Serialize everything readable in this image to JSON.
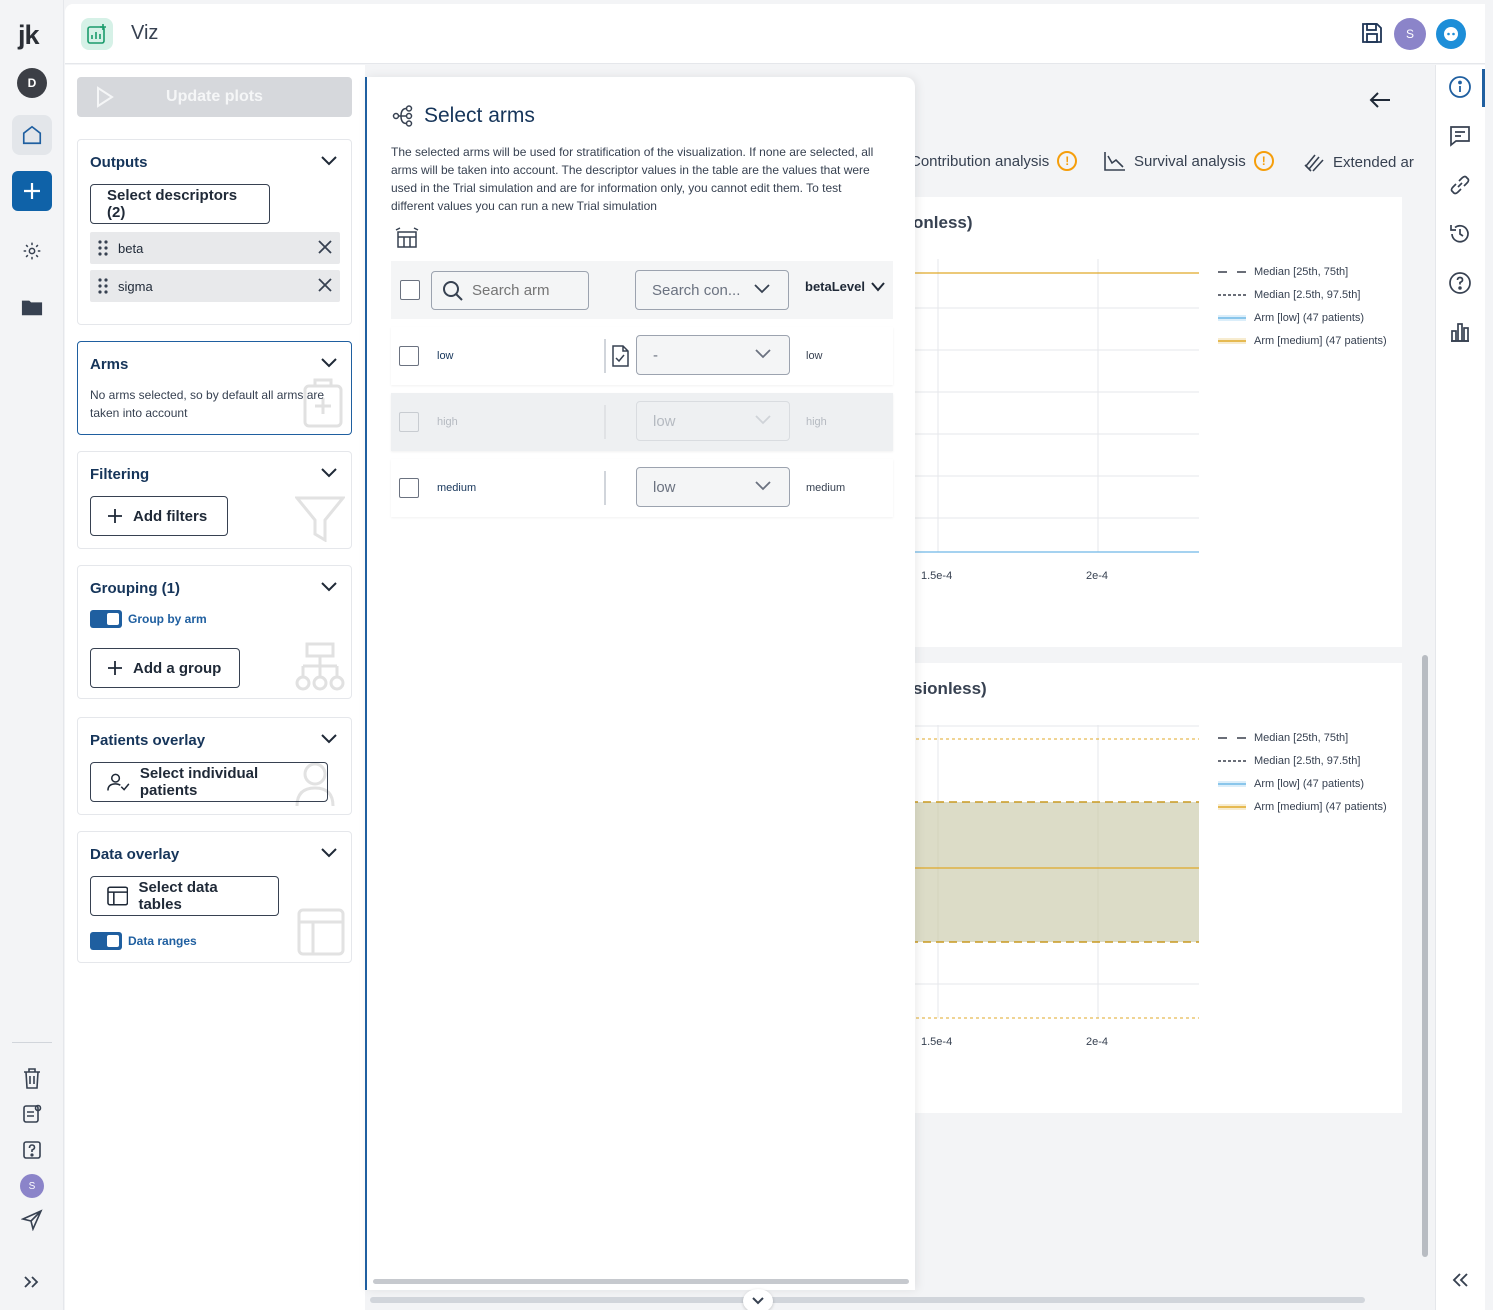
{
  "app": {
    "logo": "jk",
    "title": "Viz",
    "user_initial": "S",
    "workspace_initial": "D"
  },
  "rail": {
    "bottom_user_initial": "S"
  },
  "config": {
    "update_label": "Update plots",
    "outputs": {
      "title": "Outputs",
      "button": "Select descriptors (2)",
      "descriptors": [
        "beta",
        "sigma"
      ]
    },
    "arms": {
      "title": "Arms",
      "note": "No arms selected, so by default all arms are taken into account"
    },
    "filtering": {
      "title": "Filtering",
      "button": "Add filters"
    },
    "grouping": {
      "title": "Grouping (1)",
      "toggle_label": "Group by arm",
      "toggle_on": true,
      "button": "Add a group"
    },
    "patients_overlay": {
      "title": "Patients overlay",
      "button": "Select individual patients"
    },
    "data_overlay": {
      "title": "Data overlay",
      "button": "Select data tables",
      "toggle_label": "Data ranges",
      "toggle_on": true
    }
  },
  "main": {
    "tabs": [
      {
        "label": "Contribution analysis",
        "warning": "!"
      },
      {
        "label": "Survival analysis",
        "warning": "!"
      },
      {
        "label": "Extended ar"
      }
    ],
    "plots": [
      {
        "title_fragment": "onless)",
        "x_ticks": [
          "1.5e-4",
          "2e-4"
        ]
      },
      {
        "title_fragment": "sionless)",
        "x_ticks": [
          "1.5e-4",
          "2e-4"
        ]
      }
    ],
    "legend": [
      {
        "label": "Median [25th, 75th]",
        "style": "dashed-long",
        "color": "#111827"
      },
      {
        "label": "Median [2.5th, 97.5th]",
        "style": "dashed-short",
        "color": "#111827"
      },
      {
        "label": "Arm [low] (47 patients)",
        "style": "band",
        "color": "#6fb8e6"
      },
      {
        "label": "Arm [medium] (47 patients)",
        "style": "band",
        "color": "#e0a928"
      }
    ]
  },
  "overlay": {
    "title": "Select arms",
    "description": "The selected arms will be used for stratification of the visualization. If none are selected, all arms will be taken into account. The descriptor values in the table are the values that were used in the Trial simulation and are for information only, you cannot edit them. To test different values you can run a new Trial simulation",
    "search_placeholder": "Search arm",
    "control_placeholder": "Search con...",
    "column_header": "betaLevel",
    "rows": [
      {
        "name": "low",
        "control": "-",
        "value": "low",
        "disabled": false
      },
      {
        "name": "high",
        "control": "low",
        "value": "high",
        "disabled": true
      },
      {
        "name": "medium",
        "control": "low",
        "value": "medium",
        "disabled": false
      }
    ]
  },
  "colors": {
    "accent": "#1f5fa0",
    "primary_button": "#0f62a8",
    "warning": "#f59e0b",
    "arm_low": "#6fb8e6",
    "arm_medium": "#e0a928"
  }
}
